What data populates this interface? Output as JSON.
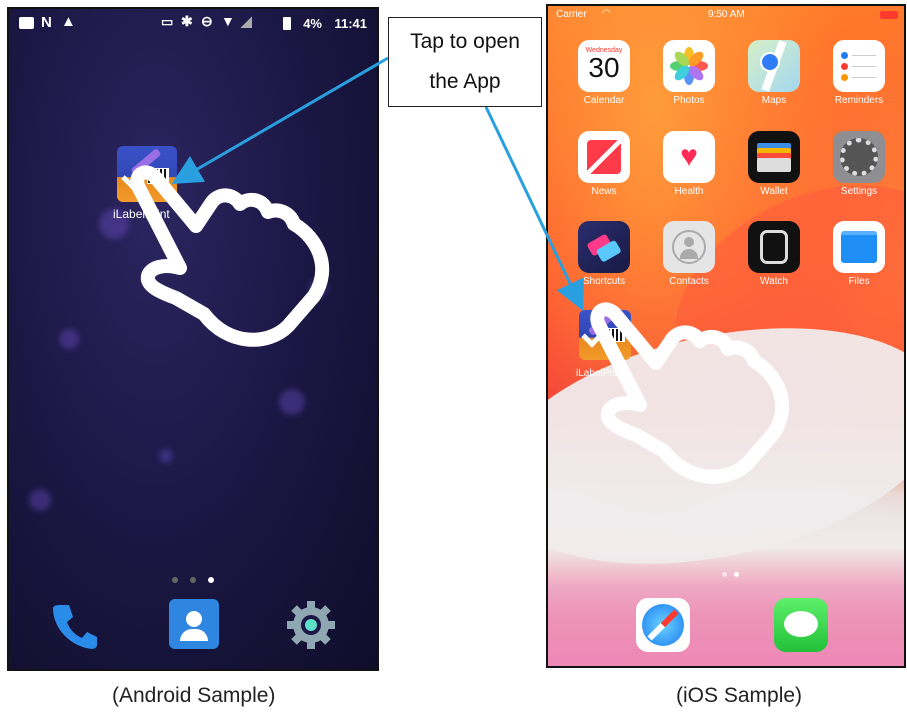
{
  "android": {
    "status": {
      "battery": "4%",
      "time": "11:41"
    },
    "app_label": "iLabelPrint",
    "dock_icons": [
      "phone-icon",
      "contacts-icon",
      "settings-icon"
    ],
    "page_dots": 3
  },
  "ios": {
    "status": {
      "carrier": "Carrier",
      "time": "9:50 AM"
    },
    "calendar": {
      "weekday": "Wednesday",
      "day": "30"
    },
    "apps": [
      {
        "label": "Calendar",
        "icon": "calendar-icon"
      },
      {
        "label": "Photos",
        "icon": "photos-icon"
      },
      {
        "label": "Maps",
        "icon": "maps-icon"
      },
      {
        "label": "Reminders",
        "icon": "reminders-icon"
      },
      {
        "label": "News",
        "icon": "news-icon"
      },
      {
        "label": "Health",
        "icon": "health-icon"
      },
      {
        "label": "Wallet",
        "icon": "wallet-icon"
      },
      {
        "label": "Settings",
        "icon": "settings-icon"
      },
      {
        "label": "Shortcuts",
        "icon": "shortcuts-icon"
      },
      {
        "label": "Contacts",
        "icon": "contacts-icon"
      },
      {
        "label": "Watch",
        "icon": "watch-icon"
      },
      {
        "label": "Files",
        "icon": "files-icon"
      }
    ],
    "app_label": "iLabelPrint",
    "dock_icons": [
      "safari-icon",
      "messages-icon"
    ]
  },
  "callout": {
    "line1": "Tap to open",
    "line2": "the App"
  },
  "captions": {
    "android": "(Android Sample)",
    "ios": "(iOS Sample)"
  },
  "colors": {
    "arrow": "#2a9fe0",
    "android_bg": "#1c1846",
    "ios_accent": "#ff4e2e"
  }
}
